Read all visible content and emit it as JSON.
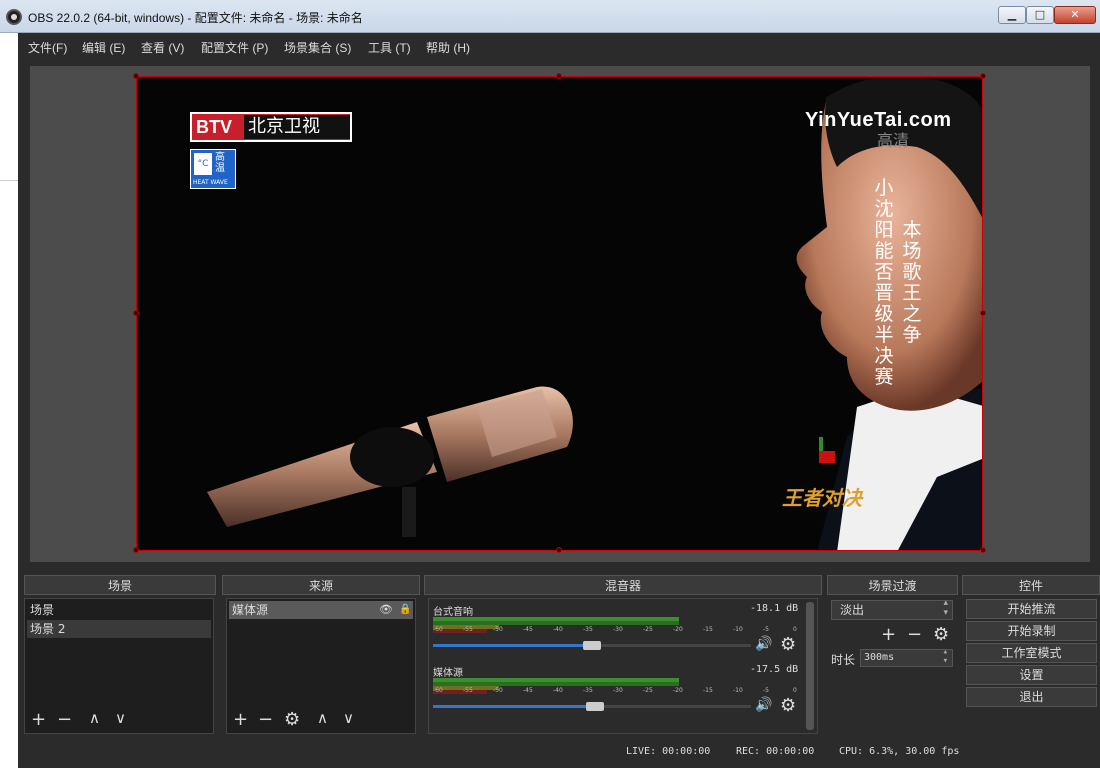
{
  "window": {
    "title": "OBS 22.0.2 (64-bit, windows) - 配置文件: 未命名 - 场景: 未命名",
    "minimize": "▁",
    "maximize": "□",
    "close": "✕"
  },
  "menu": [
    "文件(F)",
    "编辑 (E)",
    "查看 (V)",
    "配置文件 (P)",
    "场景集合 (S)",
    "工具 (T)",
    "帮助 (H)"
  ],
  "preview": {
    "btv_mark": "BTV",
    "btv_name": "北京卫视",
    "heat_badge_temp": "°C",
    "heat_badge_cn": "高温",
    "heat_badge_en": "HEAT WAVE",
    "watermark": "YinYueTai.com",
    "hd_tag": "高清",
    "caption_1": "小沈阳能否晋级半决赛",
    "caption_2": "本场歌王之争",
    "show_logo": "王者对决"
  },
  "docks": {
    "scenes_title": "场景",
    "sources_title": "来源",
    "mixer_title": "混音器",
    "transitions_title": "场景过渡",
    "controls_title": "控件"
  },
  "scenes": [
    "场景",
    "场景 2"
  ],
  "sources": [
    "媒体源"
  ],
  "mixer": {
    "channels": [
      {
        "name": "台式音响",
        "db": "-18.1 dB",
        "volume": 0.5
      },
      {
        "name": "媒体源",
        "db": "-17.5 dB",
        "volume": 0.51
      }
    ],
    "ticks": [
      "-60",
      "-55",
      "-50",
      "-45",
      "-40",
      "-35",
      "-30",
      "-25",
      "-20",
      "-15",
      "-10",
      "-5",
      "0"
    ]
  },
  "transitions": {
    "selected": "淡出",
    "duration_label": "时长",
    "duration_value": "300ms"
  },
  "controls": [
    "开始推流",
    "开始录制",
    "工作室模式",
    "设置",
    "退出"
  ],
  "status": {
    "live": "LIVE: 00:00:00",
    "rec": "REC: 00:00:00",
    "cpu": "CPU: 6.3%, 30.00 fps"
  },
  "icons": {
    "add": "+",
    "remove": "−",
    "up": "∧",
    "down": "∨",
    "gear": "⚙",
    "speaker": "🔊",
    "eye": "👁",
    "lock": "🔒",
    "spin_up": "▴",
    "spin_down": "▾"
  },
  "colors": {
    "panel_bg": "#2b2b2b",
    "accent_blue": "#3377cc",
    "selection_border": "#cc0000",
    "btv_red": "#c8202a"
  }
}
